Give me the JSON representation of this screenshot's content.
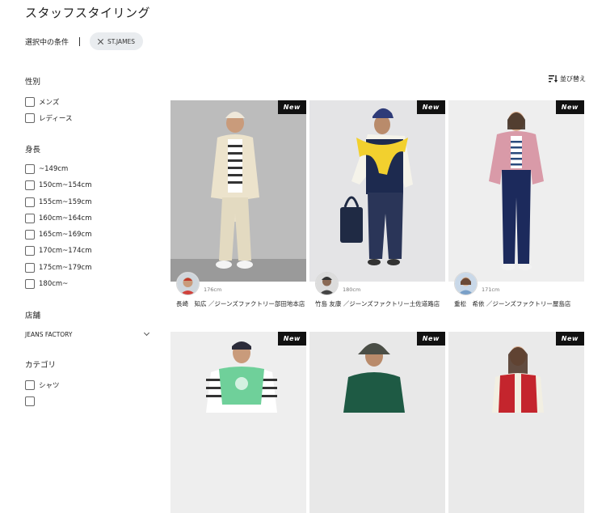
{
  "page": {
    "title": "スタッフスタイリング"
  },
  "conditions": {
    "label": "選択中の条件",
    "chips": [
      {
        "label": "ST.JAMES"
      }
    ]
  },
  "filters": {
    "gender": {
      "heading": "性別",
      "options": [
        "メンズ",
        "レディース"
      ]
    },
    "height": {
      "heading": "身長",
      "options": [
        "~149cm",
        "150cm~154cm",
        "155cm~159cm",
        "160cm~164cm",
        "165cm~169cm",
        "170cm~174cm",
        "175cm~179cm",
        "180cm~"
      ]
    },
    "shop": {
      "heading": "店舗",
      "selected": "JEANS FACTORY"
    },
    "category": {
      "heading": "カテゴリ",
      "options": [
        "シャツ"
      ]
    }
  },
  "sort": {
    "label": "並び替え"
  },
  "badge": {
    "label": "New"
  },
  "cards": [
    {
      "height": "176cm",
      "name": "長崎　知広 ／ジーンズファクトリー部田地本店"
    },
    {
      "height": "180cm",
      "name": "竹島 友康 ／ジーンズファクトリー土佐道路店"
    },
    {
      "height": "171cm",
      "name": "重松　希依 ／ジーンズファクトリー屋島店"
    },
    {
      "height": "",
      "name": ""
    },
    {
      "height": "",
      "name": ""
    },
    {
      "height": "",
      "name": ""
    }
  ],
  "icons": {
    "remove": "close-icon",
    "dropdown": "chevron-down-icon",
    "sort": "sort-icon"
  }
}
